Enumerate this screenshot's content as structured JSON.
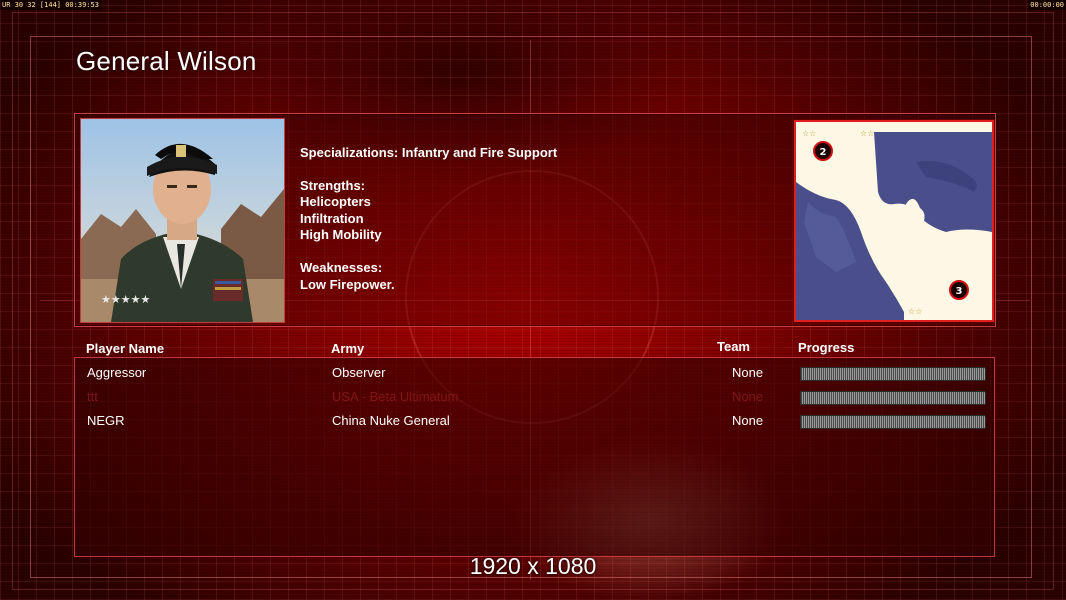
{
  "hud": {
    "left": "UR 30 32 [144] 00:39:53",
    "right": "00:00:00"
  },
  "general": {
    "name": "General Wilson",
    "specializations": "Specializations: Infantry and Fire Support",
    "strengths_label": "Strengths:",
    "strengths": [
      "Helicopters",
      "Infiltration",
      "High Mobility"
    ],
    "weaknesses_label": "Weaknesses:",
    "weaknesses": [
      "Low Firepower."
    ],
    "rank_stars": "★★★★★"
  },
  "map": {
    "spawn_markers": [
      "2",
      "3"
    ],
    "start_icon": "☆☆"
  },
  "players_table": {
    "headers": {
      "name": "Player Name",
      "army": "Army",
      "team": "Team",
      "progress": "Progress"
    },
    "rows": [
      {
        "name": "Aggressor",
        "army": "Observer",
        "team": "None",
        "dim": false
      },
      {
        "name": "ttt",
        "army": "USA - Beta Ultimatum",
        "team": "None",
        "dim": true
      },
      {
        "name": "NEGR",
        "army": "China Nuke General",
        "team": "None",
        "dim": false
      }
    ]
  },
  "resolution": "1920 x 1080",
  "colors": {
    "accent_red": "#e02020",
    "map_land": "#fdf8e6",
    "map_water": "#4a4f8c"
  }
}
